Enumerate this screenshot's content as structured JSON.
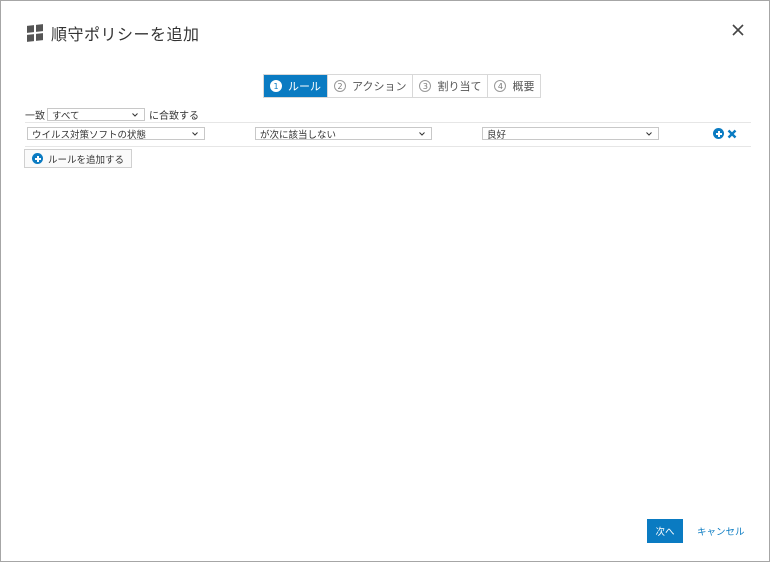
{
  "dialog": {
    "title": "順守ポリシーを追加",
    "close_label": "×"
  },
  "steps": [
    {
      "num": "1",
      "label": "ルール",
      "active": true
    },
    {
      "num": "2",
      "label": "アクション",
      "active": false
    },
    {
      "num": "3",
      "label": "割り当て",
      "active": false
    },
    {
      "num": "4",
      "label": "概要",
      "active": false
    }
  ],
  "match": {
    "prefix": "一致",
    "selected": "すべて",
    "suffix": "に合致する"
  },
  "rule": {
    "field": "ウイルス対策ソフトの状態",
    "operator": "が次に該当しない",
    "value": "良好"
  },
  "add_rule_label": "ルールを追加する",
  "footer": {
    "next_label": "次へ",
    "cancel_label": "キャンセル"
  },
  "colors": {
    "accent": "#0a7bc2"
  }
}
